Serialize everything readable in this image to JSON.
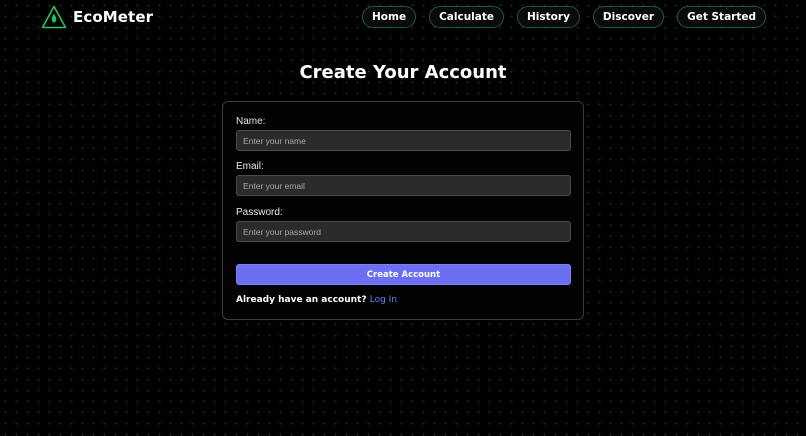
{
  "brand": {
    "name": "EcoMeter",
    "logo_icon": "leaf-triangle-icon",
    "accent": "#22c55e"
  },
  "nav": {
    "items": [
      {
        "label": "Home"
      },
      {
        "label": "Calculate"
      },
      {
        "label": "History"
      },
      {
        "label": "Discover"
      },
      {
        "label": "Get Started"
      }
    ]
  },
  "page": {
    "title": "Create Your Account"
  },
  "form": {
    "name_label": "Name:",
    "name_placeholder": "Enter your name",
    "email_label": "Email:",
    "email_placeholder": "Enter your email",
    "password_label": "Password:",
    "password_placeholder": "Enter your password",
    "submit_label": "Create Account",
    "submit_color": "#6c6ff2",
    "login_prompt": "Already have an account?",
    "login_link": "Log In"
  }
}
